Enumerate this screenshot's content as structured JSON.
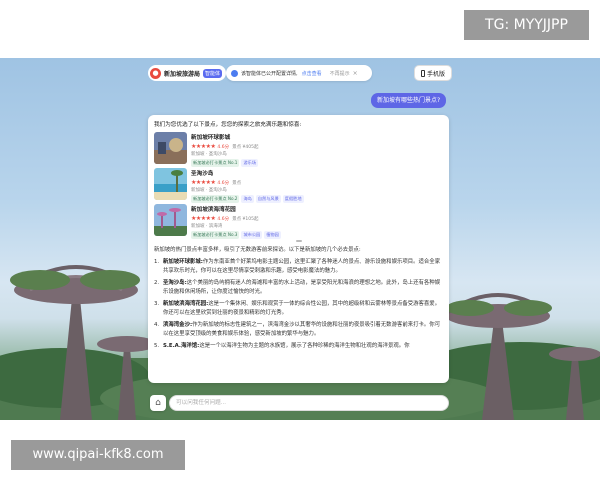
{
  "watermarks": {
    "top": "TG: MYYJJPP",
    "bottom": "www.qipai-kfk8.com"
  },
  "header": {
    "brand_name": "新加坡旅游局",
    "brand_badge": "智能体",
    "notice_text": "该智能体已公开配置详情,",
    "notice_link": "点击查看",
    "notice_dismiss": "不再提示",
    "notice_close": "×",
    "mobile_label": "手机版"
  },
  "user_message": "新加坡有哪些热门景点?",
  "answer": {
    "intro": "我们为您优选了以下景点，您您的探索之旅充满乐趣和惊喜:",
    "items": [
      {
        "name": "新加坡环球影城",
        "stars": "★★★★★",
        "score": "4.6分",
        "meta": "景点 ¥405起",
        "location": "新加坡 · 圣淘沙岛",
        "tags": [
          "新加坡必打卡景点 No.1",
          "游乐场"
        ]
      },
      {
        "name": "圣淘沙岛",
        "stars": "★★★★★",
        "score": "4.6分",
        "meta": "景点",
        "location": "新加坡 · 圣淘沙岛",
        "tags": [
          "新加坡必打卡景点 No.2",
          "海岛",
          "自然与风景",
          "度假胜地"
        ]
      },
      {
        "name": "新加坡滨海湾花园",
        "stars": "★★★★★",
        "score": "4.6分",
        "meta": "景点 ¥105起",
        "location": "新加坡 · 滨海湾",
        "tags": [
          "新加坡必打卡景点 No.3",
          "城市公园",
          "植物园"
        ]
      }
    ],
    "summary": "新加坡的热门景点丰富多样，吸引了无数游客前来探访。以下是新加坡的几个必去景点:",
    "list": [
      {
        "num": "1.",
        "title": "新加坡环球影城:",
        "text": "作为东南亚首个好莱坞电影主题公园，这里汇聚了各种迷人的景点、游乐设施和娱乐项目。适合全家共享欢乐时光，你可以在这里尽情享受刺激和乐趣，感受电影魔法的魅力。"
      },
      {
        "num": "2.",
        "title": "圣淘沙岛:",
        "text": "这个美丽的岛屿拥有迷人的海滩和丰富的水上活动，是享受阳光和海浪的理想之地。此外，岛上还有各种娱乐设施和休闲场所，让你度过愉快的时光。"
      },
      {
        "num": "3.",
        "title": "新加坡滨海湾花园:",
        "text": "这是一个集休闲、娱乐和观赏于一体的综合性公园，其中的超级树和云雾林等景点备受游客喜爱。你还可以在这里欣赏到壮丽的夜景和精彩的灯光秀。"
      },
      {
        "num": "4.",
        "title": "滨海湾金沙:",
        "text": "作为新加坡的标志性建筑之一，滨海湾金沙以其奢华的设施和壮丽的夜景吸引着无数游客前来打卡。你可以在这里享受顶级的美食和娱乐体验，感受新加坡的繁华与魅力。"
      },
      {
        "num": "5.",
        "title": "S.E.A.海洋馆:",
        "text": "这是一个以海洋生物为主题的水族馆，展示了各种珍稀的海洋生物和壮观的海洋景观。你"
      }
    ]
  },
  "input": {
    "placeholder": "可以问我任何问题..."
  },
  "colors": {
    "accent": "#5e66e6",
    "star": "#e94a3f",
    "brand": "#e94a3f"
  }
}
